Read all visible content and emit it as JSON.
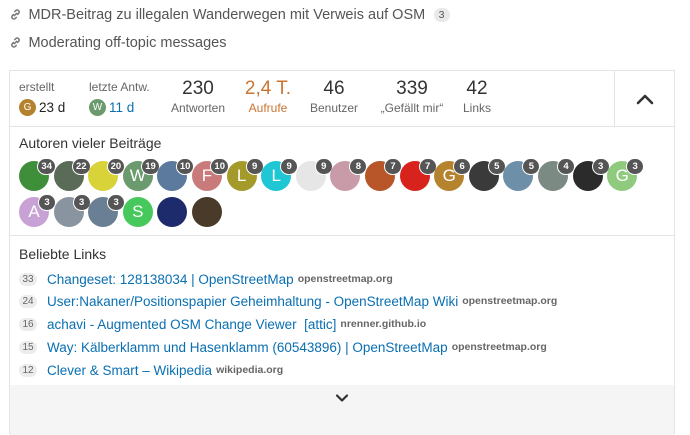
{
  "related_topics": [
    {
      "title": "MDR-Beitrag zu illegalen Wanderwegen mit Verweis auf OSM",
      "count": "3"
    },
    {
      "title": "Moderating off-topic messages",
      "count": ""
    }
  ],
  "stats": {
    "created": {
      "label": "erstellt",
      "avatar_letter": "G",
      "avatar_color": "#b5832e",
      "age": "23 d"
    },
    "last_reply": {
      "label": "letzte Antw.",
      "avatar_letter": "W",
      "avatar_color": "#6a9a6e",
      "age": "11 d"
    },
    "replies": {
      "value": "230",
      "label": "Antworten"
    },
    "views": {
      "value": "2,4 T.",
      "label": "Aufrufe"
    },
    "users": {
      "value": "46",
      "label": "Benutzer"
    },
    "likes": {
      "value": "339",
      "label": "„Gefällt mir“"
    },
    "links": {
      "value": "42",
      "label": "Links"
    }
  },
  "authors_title": "Autoren vieler Beiträge",
  "authors": [
    {
      "letter": "",
      "color": "#3f8f3a",
      "count": "34"
    },
    {
      "letter": "",
      "color": "#5a6b57",
      "count": "22"
    },
    {
      "letter": "",
      "color": "#d8d338",
      "count": "20"
    },
    {
      "letter": "W",
      "color": "#6a9a6e",
      "count": "19"
    },
    {
      "letter": "",
      "color": "#5b7a9e",
      "count": "10"
    },
    {
      "letter": "F",
      "color": "#c97a7a",
      "count": "10"
    },
    {
      "letter": "L",
      "color": "#a39a2a",
      "count": "9"
    },
    {
      "letter": "L",
      "color": "#1fc7d4",
      "count": "9"
    },
    {
      "letter": "",
      "color": "#e6e6e6",
      "count": "9"
    },
    {
      "letter": "",
      "color": "#c99aa8",
      "count": "8"
    },
    {
      "letter": "",
      "color": "#b8562a",
      "count": "7"
    },
    {
      "letter": "",
      "color": "#d7231c",
      "count": "7"
    },
    {
      "letter": "G",
      "color": "#b5832e",
      "count": "6"
    },
    {
      "letter": "",
      "color": "#3a3a3a",
      "count": "5"
    },
    {
      "letter": "",
      "color": "#6d8fa8",
      "count": "5"
    },
    {
      "letter": "",
      "color": "#7b8a82",
      "count": "4"
    },
    {
      "letter": "",
      "color": "#2b2b2b",
      "count": "3"
    },
    {
      "letter": "G",
      "color": "#8fca7f",
      "count": "3"
    },
    {
      "letter": "A",
      "color": "#c8a2d4",
      "count": "3"
    },
    {
      "letter": "",
      "color": "#8a94a0",
      "count": "3"
    },
    {
      "letter": "",
      "color": "#6a7f93",
      "count": "3"
    },
    {
      "letter": "S",
      "color": "#46c85c",
      "count": ""
    },
    {
      "letter": "",
      "color": "#1d2a6b",
      "count": ""
    },
    {
      "letter": "",
      "color": "#4a3a2a",
      "count": ""
    }
  ],
  "links_title": "Beliebte Links",
  "popular_links": [
    {
      "clicks": "33",
      "title": "Changeset: 128138034 | OpenStreetMap",
      "domain": "openstreetmap.org"
    },
    {
      "clicks": "24",
      "title": "User:Nakaner/Positionspapier Geheimhaltung - OpenStreetMap Wiki",
      "domain": "openstreetmap.org"
    },
    {
      "clicks": "16",
      "title": "achavi - Augmented OSM Change Viewer  [attic]",
      "domain": "nrenner.github.io"
    },
    {
      "clicks": "15",
      "title": "Way: Kälberklamm und Hasenklamm (60543896) | OpenStreetMap",
      "domain": "openstreetmap.org"
    },
    {
      "clicks": "12",
      "title": "Clever & Smart – Wikipedia",
      "domain": "wikipedia.org"
    }
  ]
}
